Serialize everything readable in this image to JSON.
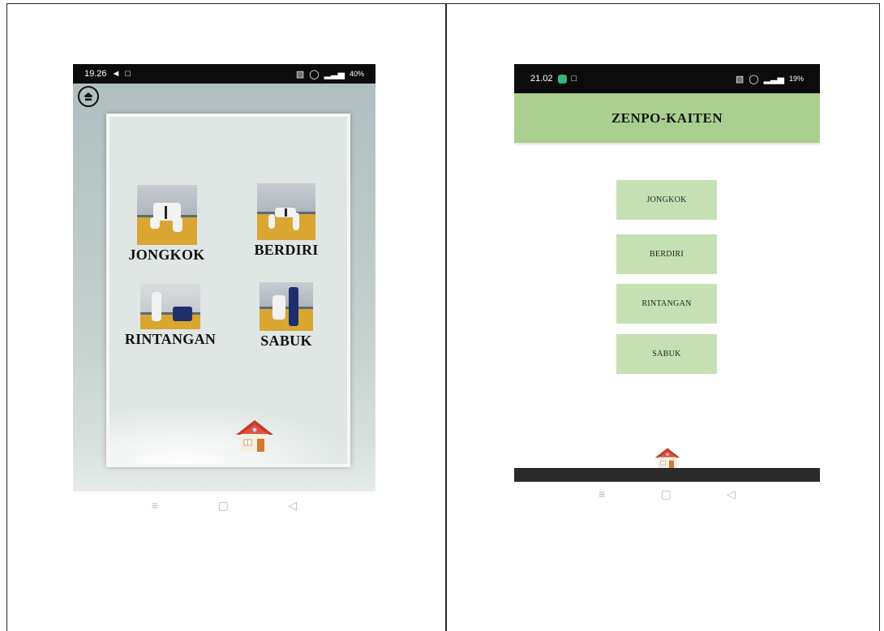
{
  "left_phone": {
    "status_bar": {
      "time": "19.26",
      "battery": "40%"
    },
    "tiles": [
      {
        "label": "JONGKOK"
      },
      {
        "label": "BERDIRI"
      },
      {
        "label": "RINTANGAN"
      },
      {
        "label": "SABUK"
      }
    ]
  },
  "right_phone": {
    "status_bar": {
      "time": "21.02",
      "battery": "19%"
    },
    "title": "ZENPO-KAITEN",
    "buttons": [
      {
        "label": "JONGKOK"
      },
      {
        "label": "BERDIRI"
      },
      {
        "label": "RINTANGAN"
      },
      {
        "label": "SABUK"
      }
    ]
  },
  "colors": {
    "app_bar": "#a9d08e",
    "menu_button": "#c5e0b3",
    "status_bar": "#0c0c0c"
  },
  "icons": [
    "home-circle-icon",
    "house-icon",
    "menu-nav-icon",
    "square-nav-icon",
    "back-triangle-icon"
  ]
}
